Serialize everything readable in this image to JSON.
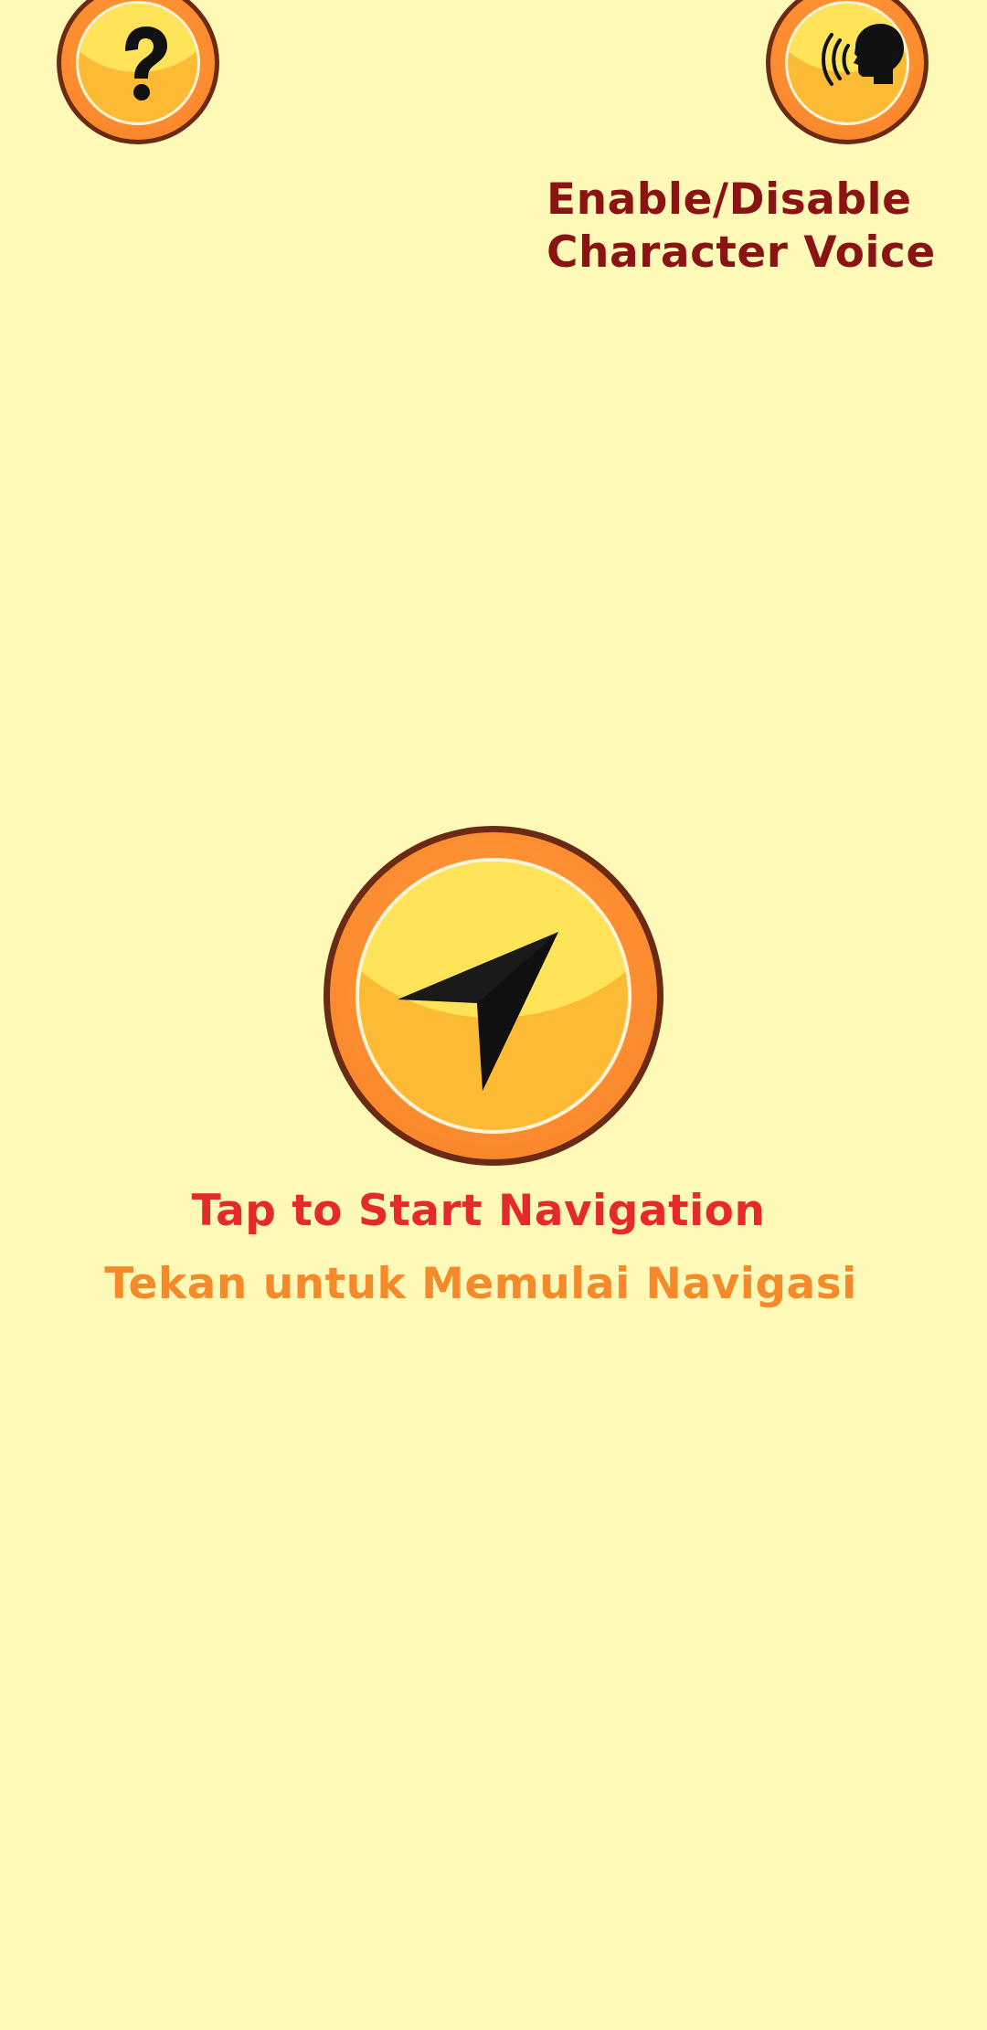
{
  "colors": {
    "background": "#FFF9B8",
    "button_outline": "#6A2A14",
    "button_ring": "#FB8A2E",
    "button_face_top": "#FFE45A",
    "button_face_bottom": "#FDBB35",
    "voice_caption": "#8A1313",
    "nav_caption_en": "#E42A2A",
    "nav_caption_id": "#F58A2A"
  },
  "help_button": {
    "icon": "question-mark-icon"
  },
  "voice_button": {
    "icon": "speaking-head-icon",
    "caption_line1": "Enable/Disable",
    "caption_line2": "Character Voice"
  },
  "nav_button": {
    "icon": "navigation-arrow-icon",
    "caption_en": "Tap to Start Navigation",
    "caption_id": "Tekan untuk Memulai Navigasi"
  }
}
